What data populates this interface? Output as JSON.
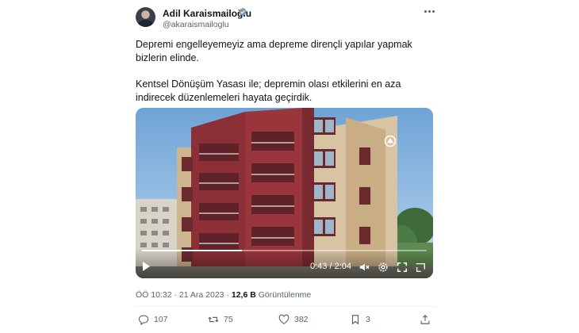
{
  "author": {
    "name": "Adil Karaismailoğlu",
    "handle": "@akaraismailoglu"
  },
  "tweet": {
    "paragraph1": "Depremi engelleyemeyiz ama depreme dirençli yapılar yapmak bizlerin elinde.",
    "paragraph2": "Kentsel Dönüşüm Yasası ile; depremin olası etkilerini en aza indirecek düzenlemeleri hayata geçirdik."
  },
  "video": {
    "current_time": "0:43",
    "separator": "/",
    "duration": "2:04",
    "progress_fraction": 0.35
  },
  "meta": {
    "time": "ÖÖ 10:32",
    "dot": "·",
    "date": "21 Ara 2023",
    "views_count": "12,6 B",
    "views_label": "Görüntülenme"
  },
  "actions": {
    "replies": "107",
    "retweets": "75",
    "likes": "382",
    "bookmarks": "3"
  },
  "icons": [
    "verified-badge-icon",
    "more-options-icon",
    "play-icon",
    "volume-icon",
    "settings-icon",
    "fullscreen-icon",
    "watermark-icon",
    "reply-icon",
    "retweet-icon",
    "like-icon",
    "bookmark-icon",
    "share-icon"
  ],
  "colors": {
    "accent": "#1d9bf0",
    "text": "#0f1419",
    "muted": "#536471"
  }
}
